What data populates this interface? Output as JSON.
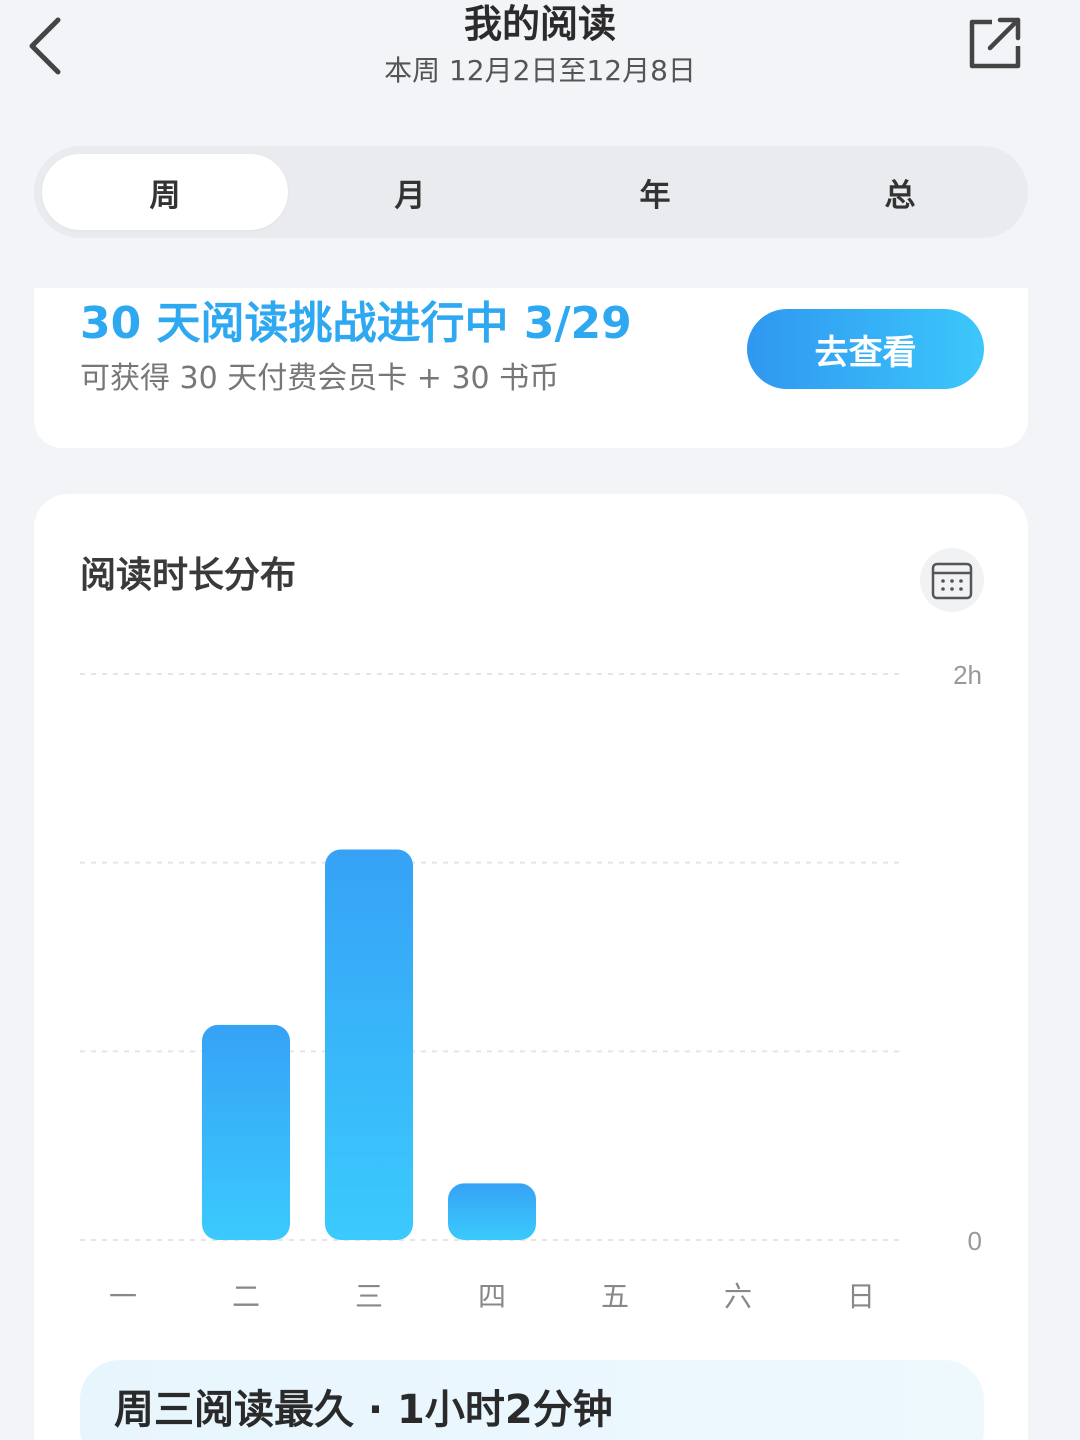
{
  "header": {
    "title": "我的阅读",
    "subtitle": "本周 12月2日至12月8日"
  },
  "icons": {
    "back": "chevron-left-icon",
    "share": "share-external-icon",
    "calendar": "calendar-icon"
  },
  "tabs": [
    {
      "label": "周",
      "active": true
    },
    {
      "label": "月",
      "active": false
    },
    {
      "label": "年",
      "active": false
    },
    {
      "label": "总",
      "active": false
    }
  ],
  "challenge": {
    "title": "30 天阅读挑战进行中 3/29",
    "description": "可获得 30 天付费会员卡 + 30 书币",
    "button_label": "去查看"
  },
  "chart_section": {
    "title": "阅读时长分布"
  },
  "chart_data": {
    "type": "bar",
    "categories": [
      "一",
      "二",
      "三",
      "四",
      "五",
      "六",
      "日"
    ],
    "values": [
      0,
      1.14,
      2.07,
      0.3,
      0,
      0,
      0
    ],
    "ylim": [
      0,
      3
    ],
    "y_tick_labels": {
      "top": "2h",
      "bottom": "0"
    },
    "gridlines": true,
    "bar_color_top": "#36a2f6",
    "bar_color_bottom": "#3bcafd"
  },
  "summary": {
    "text": "周三阅读最久 · 1小时2分钟"
  },
  "colors": {
    "accent": "#2fa8f2",
    "background": "#f2f4f7"
  }
}
